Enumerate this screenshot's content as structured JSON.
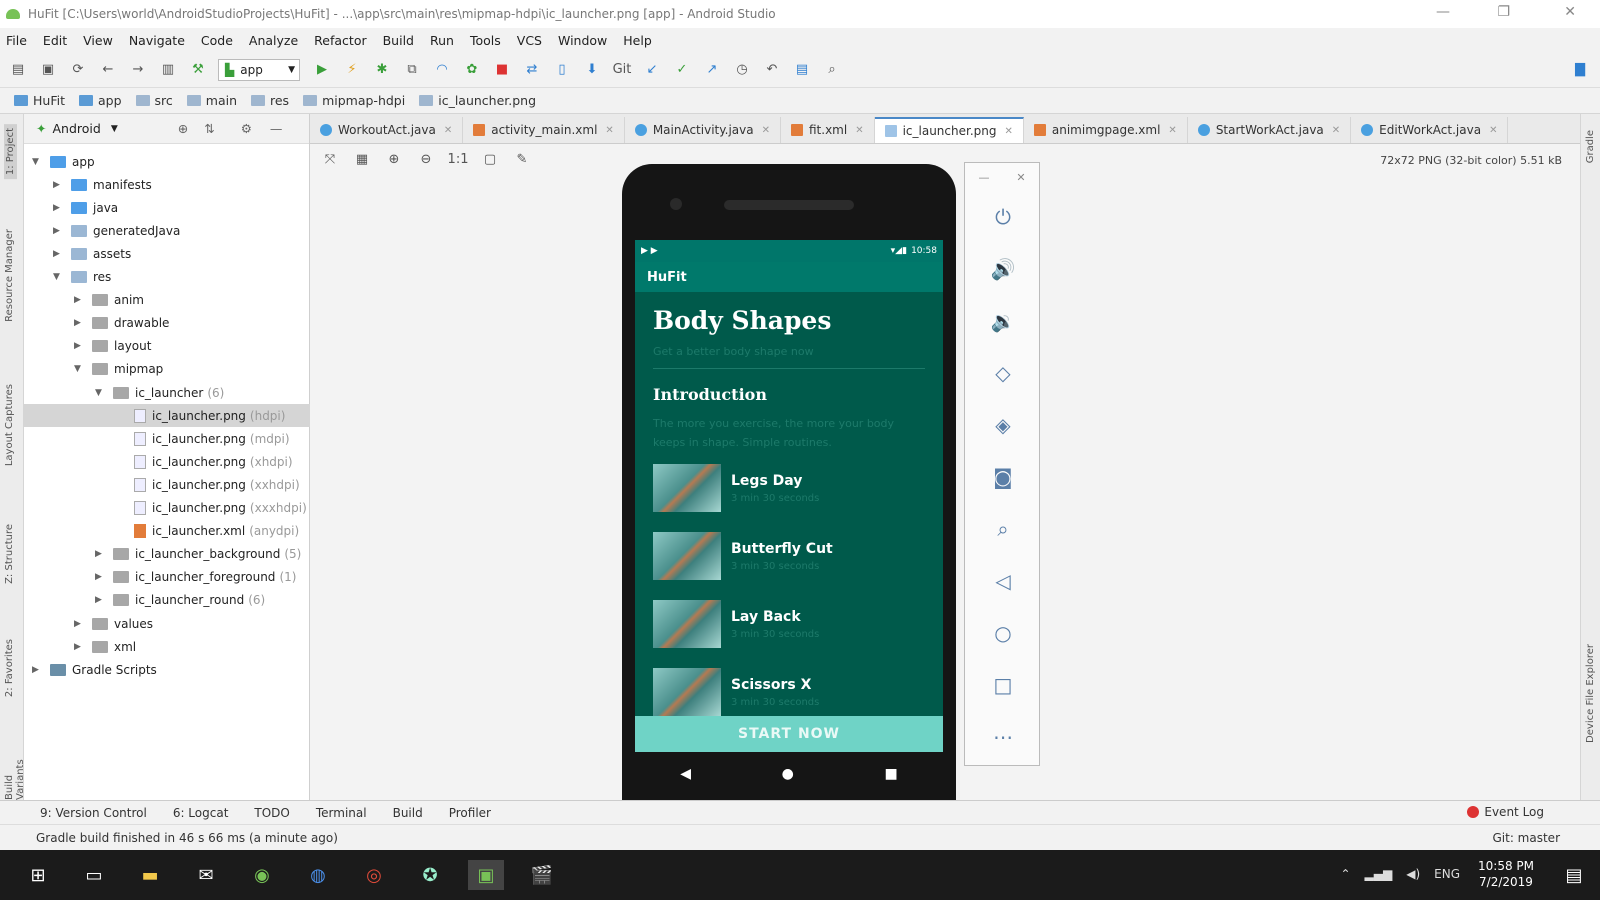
{
  "window": {
    "title": "HuFit [C:\\Users\\world\\AndroidStudioProjects\\HuFit] - ...\\app\\src\\main\\res\\mipmap-hdpi\\ic_launcher.png [app] - Android Studio"
  },
  "menu": [
    "File",
    "Edit",
    "View",
    "Navigate",
    "Code",
    "Analyze",
    "Refactor",
    "Build",
    "Run",
    "Tools",
    "VCS",
    "Window",
    "Help"
  ],
  "toolbar": {
    "app_selector": "app"
  },
  "breadcrumbs": [
    "HuFit",
    "app",
    "src",
    "main",
    "res",
    "mipmap-hdpi",
    "ic_launcher.png"
  ],
  "project": {
    "view": "Android",
    "tree": [
      {
        "label": "app",
        "depth": 0,
        "open": true,
        "kind": "folder-b"
      },
      {
        "label": "manifests",
        "depth": 1,
        "kind": "folder-b"
      },
      {
        "label": "java",
        "depth": 1,
        "kind": "folder-b"
      },
      {
        "label": "generatedJava",
        "depth": 1,
        "kind": "folder"
      },
      {
        "label": "assets",
        "depth": 1,
        "kind": "folder"
      },
      {
        "label": "res",
        "depth": 1,
        "open": true,
        "kind": "folder"
      },
      {
        "label": "anim",
        "depth": 2,
        "kind": "folder-g"
      },
      {
        "label": "drawable",
        "depth": 2,
        "kind": "folder-g"
      },
      {
        "label": "layout",
        "depth": 2,
        "kind": "folder-g"
      },
      {
        "label": "mipmap",
        "depth": 2,
        "open": true,
        "kind": "folder-g"
      },
      {
        "label": "ic_launcher",
        "extra": "(6)",
        "depth": 3,
        "open": true,
        "kind": "folder-g"
      },
      {
        "label": "ic_launcher.png",
        "extra": "(hdpi)",
        "depth": 4,
        "kind": "img",
        "selected": true
      },
      {
        "label": "ic_launcher.png",
        "extra": "(mdpi)",
        "depth": 4,
        "kind": "img"
      },
      {
        "label": "ic_launcher.png",
        "extra": "(xhdpi)",
        "depth": 4,
        "kind": "img"
      },
      {
        "label": "ic_launcher.png",
        "extra": "(xxhdpi)",
        "depth": 4,
        "kind": "img"
      },
      {
        "label": "ic_launcher.png",
        "extra": "(xxxhdpi)",
        "depth": 4,
        "kind": "img"
      },
      {
        "label": "ic_launcher.xml",
        "extra": "(anydpi)",
        "depth": 4,
        "kind": "xml"
      },
      {
        "label": "ic_launcher_background",
        "extra": "(5)",
        "depth": 3,
        "kind": "folder-g"
      },
      {
        "label": "ic_launcher_foreground",
        "extra": "(1)",
        "depth": 3,
        "kind": "folder-g"
      },
      {
        "label": "ic_launcher_round",
        "extra": "(6)",
        "depth": 3,
        "kind": "folder-g"
      },
      {
        "label": "values",
        "depth": 2,
        "kind": "folder-g"
      },
      {
        "label": "xml",
        "depth": 2,
        "kind": "folder-g"
      },
      {
        "label": "Gradle Scripts",
        "depth": 0,
        "kind": "gradle"
      }
    ]
  },
  "side_tabs": {
    "project": "1: Project",
    "resource": "Resource Manager",
    "layout": "Layout Captures",
    "structure": "Z: Structure",
    "favorites": "2: Favorites",
    "build": "Build Variants",
    "gradle": "Gradle",
    "device": "Device File Explorer"
  },
  "tabs": [
    {
      "label": "WorkoutAct.java",
      "kind": "java"
    },
    {
      "label": "activity_main.xml",
      "kind": "xml"
    },
    {
      "label": "MainActivity.java",
      "kind": "java"
    },
    {
      "label": "fit.xml",
      "kind": "xml"
    },
    {
      "label": "ic_launcher.png",
      "kind": "png",
      "active": true
    },
    {
      "label": "animimgpage.xml",
      "kind": "xml"
    },
    {
      "label": "StartWorkAct.java",
      "kind": "java"
    },
    {
      "label": "EditWorkAct.java",
      "kind": "java"
    }
  ],
  "image_meta": "72x72 PNG (32-bit color) 5.51 kB",
  "phone": {
    "time": "10:58",
    "app_title": "HuFit",
    "heading": "Body Shapes",
    "subtitle": "Get a better body shape now",
    "section": "Introduction",
    "intro": "The more you exercise, the more your body keeps in shape. Simple routines.",
    "items": [
      {
        "title": "Legs Day",
        "sub": "3 min 30 seconds"
      },
      {
        "title": "Butterfly Cut",
        "sub": "3 min 30 seconds"
      },
      {
        "title": "Lay Back",
        "sub": "3 min 30 seconds"
      },
      {
        "title": "Scissors X",
        "sub": "3 min 30 seconds"
      }
    ],
    "start": "START NOW"
  },
  "bottom_tabs": [
    "9: Version Control",
    "6: Logcat",
    "TODO",
    "Terminal",
    "Build",
    "Profiler"
  ],
  "event_log": "Event Log",
  "status": {
    "message": "Gradle build finished in 46 s 66 ms (a minute ago)",
    "git": "Git: master"
  },
  "system": {
    "lang": "ENG",
    "time": "10:58 PM",
    "date": "7/2/2019"
  }
}
